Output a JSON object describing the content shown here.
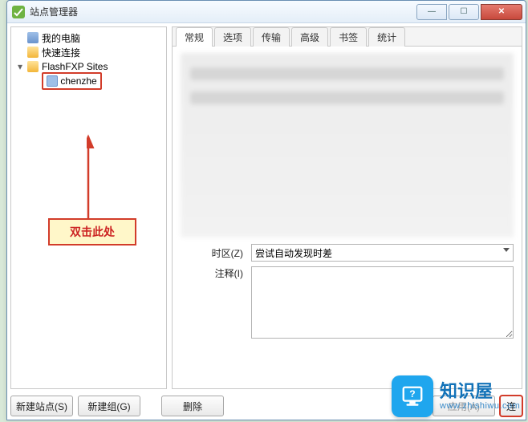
{
  "window": {
    "title": "站点管理器"
  },
  "tree": {
    "my_computer": "我的电脑",
    "quick_connect": "快速连接",
    "sites_folder": "FlashFXP Sites",
    "site_item": "chenzhe"
  },
  "tabs": {
    "general": "常规",
    "options": "选项",
    "transfer": "传输",
    "advanced": "高级",
    "bookmarks": "书签",
    "stats": "统计"
  },
  "form": {
    "timezone_label": "时区(Z)",
    "timezone_value": "尝试自动发现时差",
    "notes_label": "注释(I)",
    "notes_value": ""
  },
  "buttons": {
    "new_site": "新建站点(S)",
    "new_group": "新建组(G)",
    "delete": "删除",
    "apply": "应用(A)",
    "connect": "连"
  },
  "annotation": {
    "callout": "双击此处"
  },
  "watermark": {
    "title": "知识屋",
    "url": "www.zhishiwu.com"
  }
}
